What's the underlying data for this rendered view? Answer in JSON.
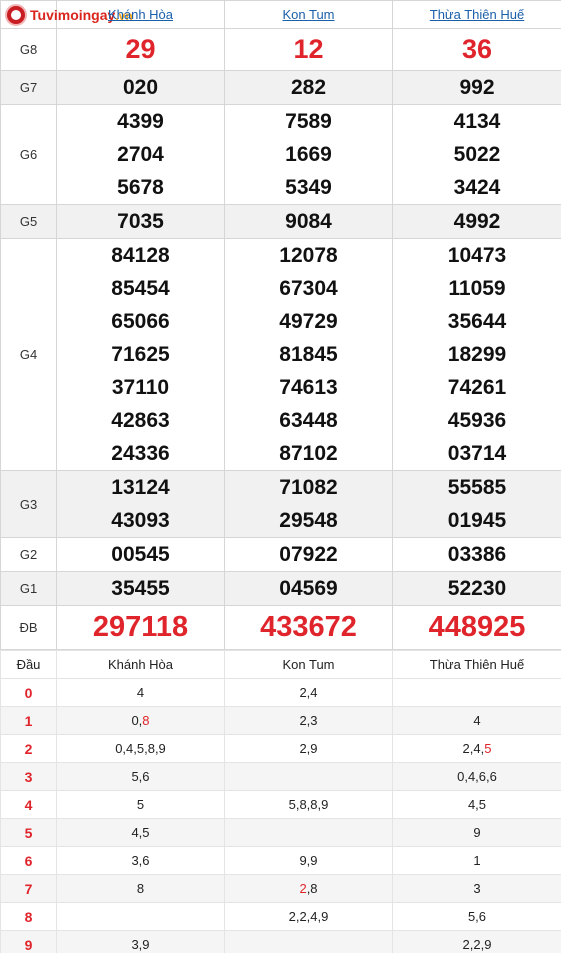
{
  "logo": {
    "brand": "Tuvimoingay",
    "suffix": ".vn",
    "badge": "TVMN"
  },
  "provinces": [
    "Khánh Hòa",
    "Kon Tum",
    "Thừa Thiên Huế"
  ],
  "prizes": [
    {
      "label": "G8",
      "values": [
        [
          "29"
        ],
        [
          "12"
        ],
        [
          "36"
        ]
      ]
    },
    {
      "label": "G7",
      "values": [
        [
          "020"
        ],
        [
          "282"
        ],
        [
          "992"
        ]
      ]
    },
    {
      "label": "G6",
      "values": [
        [
          "4399",
          "2704",
          "5678"
        ],
        [
          "7589",
          "1669",
          "5349"
        ],
        [
          "4134",
          "5022",
          "3424"
        ]
      ]
    },
    {
      "label": "G5",
      "values": [
        [
          "7035"
        ],
        [
          "9084"
        ],
        [
          "4992"
        ]
      ]
    },
    {
      "label": "G4",
      "values": [
        [
          "84128",
          "85454",
          "65066",
          "71625",
          "37110",
          "42863",
          "24336"
        ],
        [
          "12078",
          "67304",
          "49729",
          "81845",
          "74613",
          "63448",
          "87102"
        ],
        [
          "10473",
          "11059",
          "35644",
          "18299",
          "74261",
          "45936",
          "03714"
        ]
      ]
    },
    {
      "label": "G3",
      "values": [
        [
          "13124",
          "43093"
        ],
        [
          "71082",
          "29548"
        ],
        [
          "55585",
          "01945"
        ]
      ]
    },
    {
      "label": "G2",
      "values": [
        [
          "00545"
        ],
        [
          "07922"
        ],
        [
          "03386"
        ]
      ]
    },
    {
      "label": "G1",
      "values": [
        [
          "35455"
        ],
        [
          "04569"
        ],
        [
          "52230"
        ]
      ]
    },
    {
      "label": "ĐB",
      "values": [
        [
          "297118"
        ],
        [
          "433672"
        ],
        [
          "448925"
        ]
      ]
    }
  ],
  "loto": {
    "header": [
      "Đầu",
      "Khánh Hòa",
      "Kon Tum",
      "Thừa Thiên Huế"
    ],
    "rows": [
      {
        "head": "0",
        "cols": [
          [
            {
              "t": "4"
            }
          ],
          [
            {
              "t": "2,4"
            }
          ],
          []
        ]
      },
      {
        "head": "1",
        "cols": [
          [
            {
              "t": "0,"
            },
            {
              "t": "8",
              "hl": true
            }
          ],
          [
            {
              "t": "2,3"
            }
          ],
          [
            {
              "t": "4"
            }
          ]
        ]
      },
      {
        "head": "2",
        "cols": [
          [
            {
              "t": "0,4,5,8,9"
            }
          ],
          [
            {
              "t": "2,9"
            }
          ],
          [
            {
              "t": "2,4,"
            },
            {
              "t": "5",
              "hl": true
            }
          ]
        ]
      },
      {
        "head": "3",
        "cols": [
          [
            {
              "t": "5,6"
            }
          ],
          [],
          [
            {
              "t": "0,4,6,6"
            }
          ]
        ]
      },
      {
        "head": "4",
        "cols": [
          [
            {
              "t": "5"
            }
          ],
          [
            {
              "t": "5,8,8,9"
            }
          ],
          [
            {
              "t": "4,5"
            }
          ]
        ]
      },
      {
        "head": "5",
        "cols": [
          [
            {
              "t": "4,5"
            }
          ],
          [],
          [
            {
              "t": "9"
            }
          ]
        ]
      },
      {
        "head": "6",
        "cols": [
          [
            {
              "t": "3,6"
            }
          ],
          [
            {
              "t": "9,9"
            }
          ],
          [
            {
              "t": "1"
            }
          ]
        ]
      },
      {
        "head": "7",
        "cols": [
          [
            {
              "t": "8"
            }
          ],
          [
            {
              "t": "2",
              "hl": true
            },
            {
              "t": ",8"
            }
          ],
          [
            {
              "t": "3"
            }
          ]
        ]
      },
      {
        "head": "8",
        "cols": [
          [],
          [
            {
              "t": "2,2,4,9"
            }
          ],
          [
            {
              "t": "5,6"
            }
          ]
        ]
      },
      {
        "head": "9",
        "cols": [
          [
            {
              "t": "3,9"
            }
          ],
          [],
          [
            {
              "t": "2,2,9"
            }
          ]
        ]
      }
    ]
  },
  "colors": {
    "accent_red": "#e0242b",
    "link_blue": "#1a5faa",
    "row_grey": "#f1f1f1"
  }
}
